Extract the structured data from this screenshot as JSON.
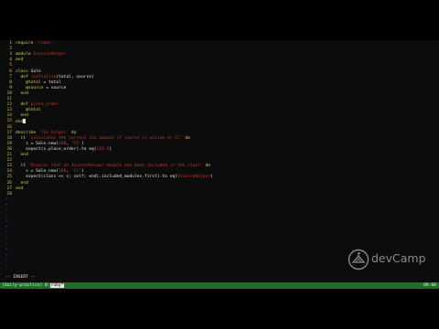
{
  "editor": {
    "lines": [
      {
        "n": "1",
        "segs": [
          {
            "c": "kw",
            "t": "require "
          },
          {
            "c": "str",
            "t": "'rspec'"
          }
        ]
      },
      {
        "n": "2",
        "segs": []
      },
      {
        "n": "3",
        "segs": [
          {
            "c": "kw",
            "t": "module "
          },
          {
            "c": "str",
            "t": "InvoiceHelper"
          }
        ]
      },
      {
        "n": "4",
        "segs": [
          {
            "c": "kw",
            "t": "end"
          }
        ]
      },
      {
        "n": "5",
        "segs": []
      },
      {
        "n": "6",
        "segs": [
          {
            "c": "kw",
            "t": "class "
          },
          {
            "c": "cls",
            "t": "Sale"
          }
        ]
      },
      {
        "n": "7",
        "segs": [
          {
            "c": "kw",
            "t": "  def "
          },
          {
            "c": "str",
            "t": "initialize"
          },
          {
            "c": "id",
            "t": "(total, source)"
          }
        ]
      },
      {
        "n": "8",
        "segs": [
          {
            "c": "kw",
            "t": "    @total"
          },
          {
            "c": "id",
            "t": " = total"
          }
        ]
      },
      {
        "n": "9",
        "segs": [
          {
            "c": "kw",
            "t": "    @source"
          },
          {
            "c": "id",
            "t": " = source"
          }
        ]
      },
      {
        "n": "10",
        "segs": [
          {
            "c": "kw",
            "t": "  end"
          }
        ]
      },
      {
        "n": "11",
        "segs": []
      },
      {
        "n": "12",
        "segs": [
          {
            "c": "kw",
            "t": "  def "
          },
          {
            "c": "str",
            "t": "place_order"
          }
        ]
      },
      {
        "n": "13",
        "segs": [
          {
            "c": "kw",
            "t": "    @total"
          }
        ]
      },
      {
        "n": "14",
        "segs": [
          {
            "c": "kw",
            "t": "  end"
          }
        ]
      },
      {
        "n": "15",
        "segs": [
          {
            "c": "kw",
            "t": "end"
          }
        ],
        "cursor": true
      },
      {
        "n": "16",
        "segs": []
      },
      {
        "n": "17",
        "segs": [
          {
            "c": "kw",
            "t": "describe "
          },
          {
            "c": "str",
            "t": "'Tax helper'"
          },
          {
            "c": "kw",
            "t": " do"
          }
        ]
      },
      {
        "n": "18",
        "segs": [
          {
            "c": "kw",
            "t": "  it "
          },
          {
            "c": "str",
            "t": "'calculates the correct tax amount if source is online or CC'"
          },
          {
            "c": "kw",
            "t": " do"
          }
        ]
      },
      {
        "n": "19",
        "segs": [
          {
            "c": "id",
            "t": "    s = Sale.new("
          },
          {
            "c": "num",
            "t": "100"
          },
          {
            "c": "id",
            "t": ", "
          },
          {
            "c": "str",
            "t": "'CC'"
          },
          {
            "c": "id",
            "t": ")"
          }
        ]
      },
      {
        "n": "20",
        "segs": [
          {
            "c": "id",
            "t": "    expect(s.place_order).to eq("
          },
          {
            "c": "num",
            "t": "110.0"
          },
          {
            "c": "id",
            "t": ")"
          }
        ]
      },
      {
        "n": "21",
        "segs": [
          {
            "c": "kw",
            "t": "  end"
          }
        ]
      },
      {
        "n": "22",
        "segs": []
      },
      {
        "n": "23",
        "segs": [
          {
            "c": "kw",
            "t": "  it "
          },
          {
            "c": "str",
            "t": "'Ensures that an InvoiceHelper module has been included in the class'"
          },
          {
            "c": "kw",
            "t": " do"
          }
        ]
      },
      {
        "n": "24",
        "segs": [
          {
            "c": "id",
            "t": "    s = Sale.new("
          },
          {
            "c": "num",
            "t": "100"
          },
          {
            "c": "id",
            "t": ", "
          },
          {
            "c": "str",
            "t": "'CC'"
          },
          {
            "c": "id",
            "t": ")"
          }
        ]
      },
      {
        "n": "25",
        "segs": [
          {
            "c": "id",
            "t": "    expect(class << s; self; end).included_modules.first).to eq("
          },
          {
            "c": "str",
            "t": "InvoiceHelper"
          },
          {
            "c": "id",
            "t": ")"
          }
        ]
      },
      {
        "n": "26",
        "segs": [
          {
            "c": "kw",
            "t": "  end"
          }
        ]
      },
      {
        "n": "27",
        "segs": [
          {
            "c": "kw",
            "t": "end"
          }
        ]
      },
      {
        "n": "28",
        "segs": []
      }
    ],
    "tilde_glyph": "~"
  },
  "status": {
    "mode": "-- INSERT --"
  },
  "tmux": {
    "session": "[daily-practice] ",
    "window_prefix": "0:",
    "window_active": "ruby*",
    "clock": "09:08"
  },
  "logo": {
    "text": "devCamp",
    "colors": {
      "mark": "#8a8a8a"
    }
  },
  "colors": {
    "keyword": "#d7d24a",
    "string": "#c0392b",
    "line_number": "#d4c04a",
    "tilde": "#3b55c8",
    "tmux_bar": "#1f6e2c"
  }
}
